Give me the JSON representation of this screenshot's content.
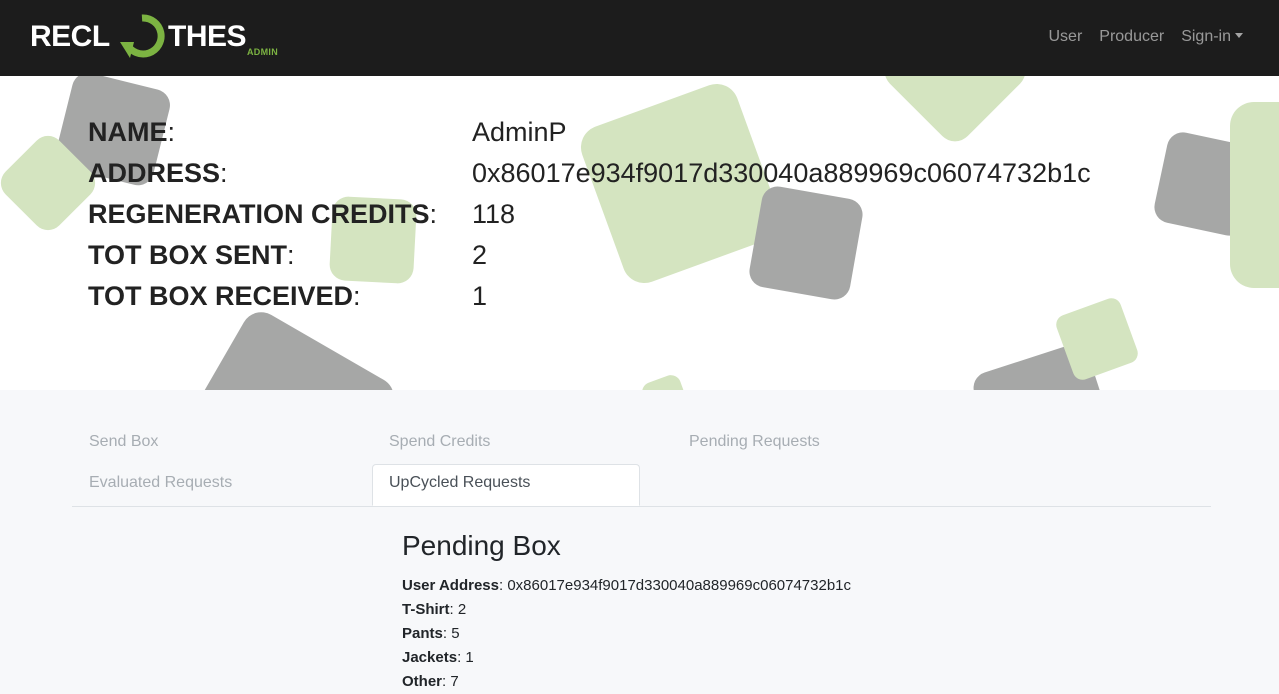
{
  "brand": {
    "name_left": "RECL",
    "name_right": "THES",
    "sub": "ADMIN",
    "accent": "#7cb342"
  },
  "nav": {
    "links": [
      {
        "label": "User"
      },
      {
        "label": "Producer"
      },
      {
        "label": "Sign-in"
      }
    ]
  },
  "profile": {
    "rows": [
      {
        "key": "NAME",
        "value": "AdminP"
      },
      {
        "key": "ADDRESS",
        "value": "0x86017e934f9017d330040a889969c06074732b1c"
      },
      {
        "key": "REGENERATION CREDITS",
        "value": "118"
      },
      {
        "key": "TOT BOX SENT",
        "value": "2"
      },
      {
        "key": "TOT BOX RECEIVED",
        "value": "1"
      }
    ]
  },
  "tabs": [
    {
      "label": "Send Box"
    },
    {
      "label": "Spend Credits"
    },
    {
      "label": "Pending Requests"
    },
    {
      "label": "Evaluated Requests"
    },
    {
      "label": "UpCycled Requests",
      "active": true
    }
  ],
  "pending_box": {
    "title": "Pending Box",
    "fields": [
      {
        "label": "User Address",
        "value": "0x86017e934f9017d330040a889969c06074732b1c"
      },
      {
        "label": "T-Shirt",
        "value": "2"
      },
      {
        "label": "Pants",
        "value": "5"
      },
      {
        "label": "Jackets",
        "value": "1"
      },
      {
        "label": "Other",
        "value": "7"
      }
    ]
  }
}
